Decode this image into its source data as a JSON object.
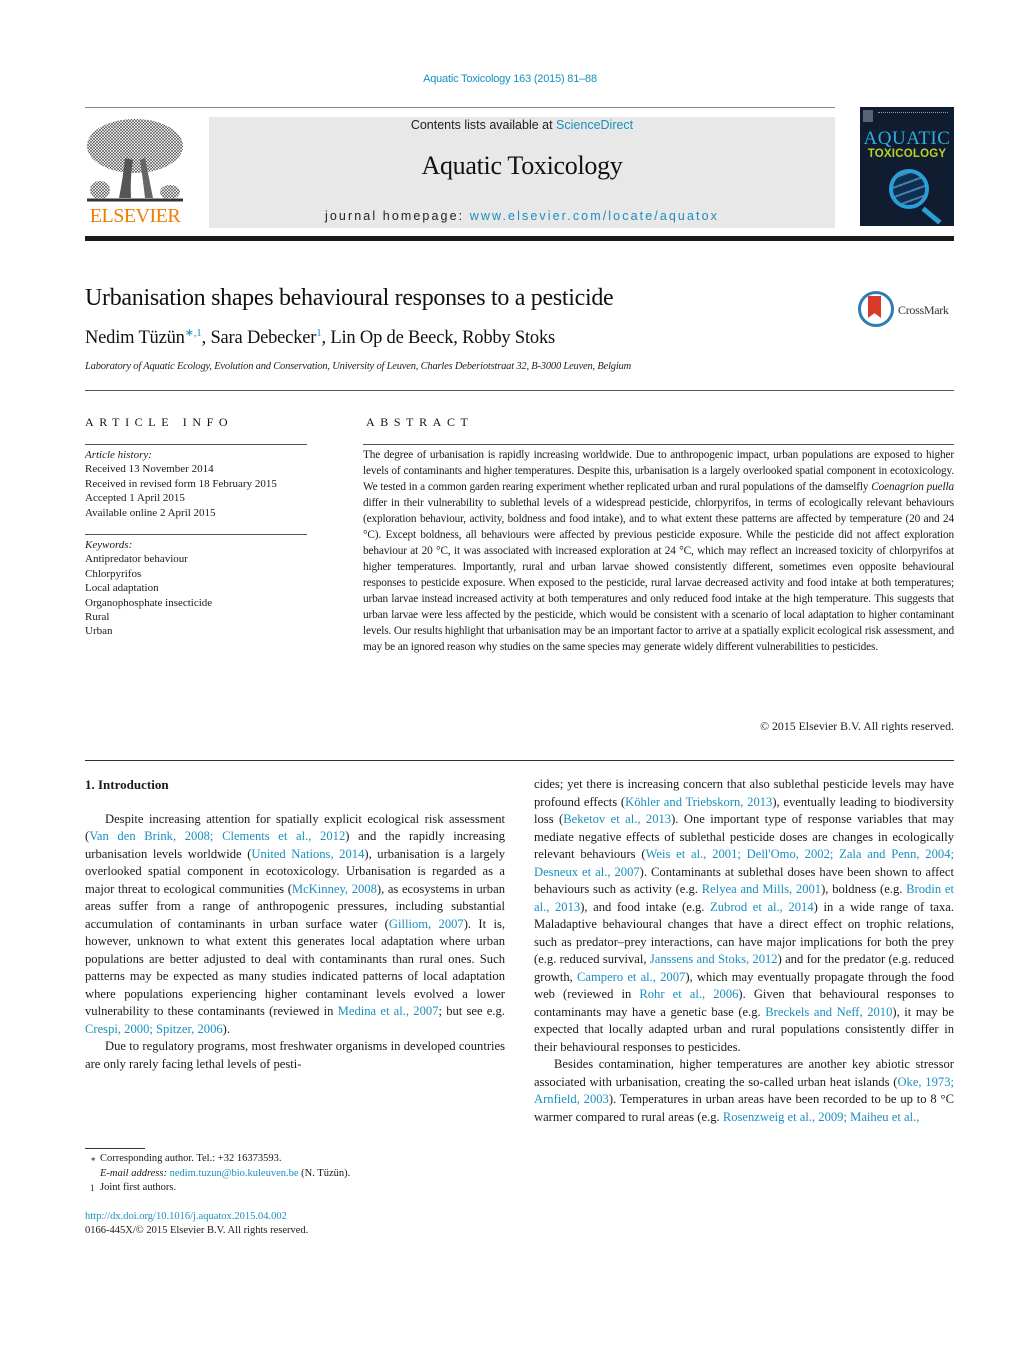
{
  "header": {
    "citation": "Aquatic Toxicology 163 (2015) 81–88",
    "contents_prefix": "Contents lists available at ",
    "contents_link": "ScienceDirect",
    "journal_name": "Aquatic Toxicology",
    "homepage_prefix": "journal homepage: ",
    "homepage_link": "www.elsevier.com/locate/aquatox",
    "publisher_logo_text": "ELSEVIER",
    "cover_title_line1": "AQUATIC",
    "cover_title_line2": "TOXICOLOGY",
    "crossmark_label": "CrossMark"
  },
  "colors": {
    "link": "#1a8fbf",
    "elsevier_orange": "#f07c00",
    "cover_bg": "#101c30",
    "cover_title_blue": "#2bb0e0",
    "cover_title_green": "#b7d02a",
    "crossmark_red": "#d9392b",
    "crossmark_blue": "#2f7db5"
  },
  "article": {
    "title": "Urbanisation shapes behavioural responses to a pesticide",
    "authors": [
      {
        "name": "Nedim Tüzün",
        "marks": "∗,1"
      },
      {
        "name": "Sara Debecker",
        "marks": "1"
      },
      {
        "name": "Lin Op de Beeck",
        "marks": ""
      },
      {
        "name": "Robby Stoks",
        "marks": ""
      }
    ],
    "affiliation": "Laboratory of Aquatic Ecology, Evolution and Conservation, University of Leuven, Charles Deberiotstraat 32, B-3000 Leuven, Belgium"
  },
  "article_info": {
    "heading": "ARTICLE INFO",
    "history_label": "Article history:",
    "history": [
      "Received 13 November 2014",
      "Received in revised form 18 February 2015",
      "Accepted 1 April 2015",
      "Available online 2 April 2015"
    ],
    "keywords_label": "Keywords:",
    "keywords": [
      "Antipredator behaviour",
      "Chlorpyrifos",
      "Local adaptation",
      "Organophosphate insecticide",
      "Rural",
      "Urban"
    ]
  },
  "abstract": {
    "heading": "ABSTRACT",
    "text_part1": "The degree of urbanisation is rapidly increasing worldwide. Due to anthropogenic impact, urban populations are exposed to higher levels of contaminants and higher temperatures. Despite this, urbanisation is a largely overlooked spatial component in ecotoxicology. We tested in a common garden rearing experiment whether replicated urban and rural populations of the damselfly ",
    "species": "Coenagrion puella",
    "text_part2": " differ in their vulnerability to sublethal levels of a widespread pesticide, chlorpyrifos, in terms of ecologically relevant behaviours (exploration behaviour, activity, boldness and food intake), and to what extent these patterns are affected by temperature (20 and 24 °C). Except boldness, all behaviours were affected by previous pesticide exposure. While the pesticide did not affect exploration behaviour at 20 °C, it was associated with increased exploration at 24 °C, which may reflect an increased toxicity of chlorpyrifos at higher temperatures. Importantly, rural and urban larvae showed consistently different, sometimes even opposite behavioural responses to pesticide exposure. When exposed to the pesticide, rural larvae decreased activity and food intake at both temperatures; urban larvae instead increased activity at both temperatures and only reduced food intake at the high temperature. This suggests that urban larvae were less affected by the pesticide, which would be consistent with a scenario of local adaptation to higher contaminant levels. Our results highlight that urbanisation may be an important factor to arrive at a spatially explicit ecological risk assessment, and may be an ignored reason why studies on the same species may generate widely different vulnerabilities to pesticides.",
    "copyright": "© 2015 Elsevier B.V. All rights reserved."
  },
  "body": {
    "section_heading": "1.  Introduction",
    "p1": [
      {
        "t": "Despite increasing attention for spatially explicit ecological risk assessment ("
      },
      {
        "l": "Van den Brink, 2008; Clements et al., 2012"
      },
      {
        "t": ") and the rapidly increasing urbanisation levels worldwide ("
      },
      {
        "l": "United Nations, 2014"
      },
      {
        "t": "), urbanisation is a largely overlooked spatial component in ecotoxicology. Urbanisation is regarded as a major threat to ecological communities ("
      },
      {
        "l": "McKinney, 2008"
      },
      {
        "t": "), as ecosystems in urban areas suffer from a range of anthropogenic pressures, including substantial accumulation of contaminants in urban surface water ("
      },
      {
        "l": "Gilliom, 2007"
      },
      {
        "t": "). It is, however, unknown to what extent this generates local adaptation where urban populations are better adjusted to deal with contaminants than rural ones. Such patterns may be expected as many studies indicated patterns of local adaptation where populations experiencing higher contaminant levels evolved a lower vulnerability to these contaminants (reviewed in "
      },
      {
        "l": "Medina et al., 2007"
      },
      {
        "t": "; but see e.g. "
      },
      {
        "l": "Crespi, 2000; Spitzer, 2006"
      },
      {
        "t": ")."
      }
    ],
    "p2_left": "Due to regulatory programs, most freshwater organisms in developed countries are only rarely facing lethal levels of pesti-",
    "p2_right": [
      {
        "t": "cides; yet there is increasing concern that also sublethal pesticide levels may have profound effects ("
      },
      {
        "l": "Köhler and Triebskorn, 2013"
      },
      {
        "t": "), eventually leading to biodiversity loss ("
      },
      {
        "l": "Beketov et al., 2013"
      },
      {
        "t": "). One important type of response variables that may mediate negative effects of sublethal pesticide doses are changes in ecologically relevant behaviours ("
      },
      {
        "l": "Weis et al., 2001; Dell'Omo, 2002; Zala and Penn, 2004; Desneux et al., 2007"
      },
      {
        "t": "). Contaminants at sublethal doses have been shown to affect behaviours such as activity (e.g. "
      },
      {
        "l": "Relyea and Mills, 2001"
      },
      {
        "t": "), boldness (e.g. "
      },
      {
        "l": "Brodin et al., 2013"
      },
      {
        "t": "), and food intake (e.g. "
      },
      {
        "l": "Zubrod et al., 2014"
      },
      {
        "t": ") in a wide range of taxa. Maladaptive behavioural changes that have a direct effect on trophic relations, such as predator–prey interactions, can have major implications for both the prey (e.g. reduced survival, "
      },
      {
        "l": "Janssens and Stoks, 2012"
      },
      {
        "t": ") and for the predator (e.g. reduced growth, "
      },
      {
        "l": "Campero et al., 2007"
      },
      {
        "t": "), which may eventually propagate through the food web (reviewed in "
      },
      {
        "l": "Rohr et al., 2006"
      },
      {
        "t": "). Given that behavioural responses to contaminants may have a genetic base (e.g. "
      },
      {
        "l": "Breckels and Neff, 2010"
      },
      {
        "t": "), it may be expected that locally adapted urban and rural populations consistently differ in their behavioural responses to pesticides."
      }
    ],
    "p3": [
      {
        "t": "Besides contamination, higher temperatures are another key abiotic stressor associated with urbanisation, creating the so-called urban heat islands ("
      },
      {
        "l": "Oke, 1973; Arnfield, 2003"
      },
      {
        "t": "). Temperatures in urban areas have been recorded to be up to 8 °C warmer compared to rural areas (e.g. "
      },
      {
        "l": "Rosenzweig et al., 2009; Maiheu et al.,"
      }
    ]
  },
  "footnotes": {
    "corresponding_mark": "∗",
    "corresponding": "Corresponding author. Tel.: +32 16373593.",
    "email_label": "E-mail address: ",
    "email": "nedim.tuzun@bio.kuleuven.be",
    "email_suffix": " (N. Tüzün).",
    "joint_mark": "1",
    "joint": "Joint first authors."
  },
  "doi": "http://dx.doi.org/10.1016/j.aquatox.2015.04.002",
  "issn": "0166-445X/© 2015 Elsevier B.V. All rights reserved."
}
